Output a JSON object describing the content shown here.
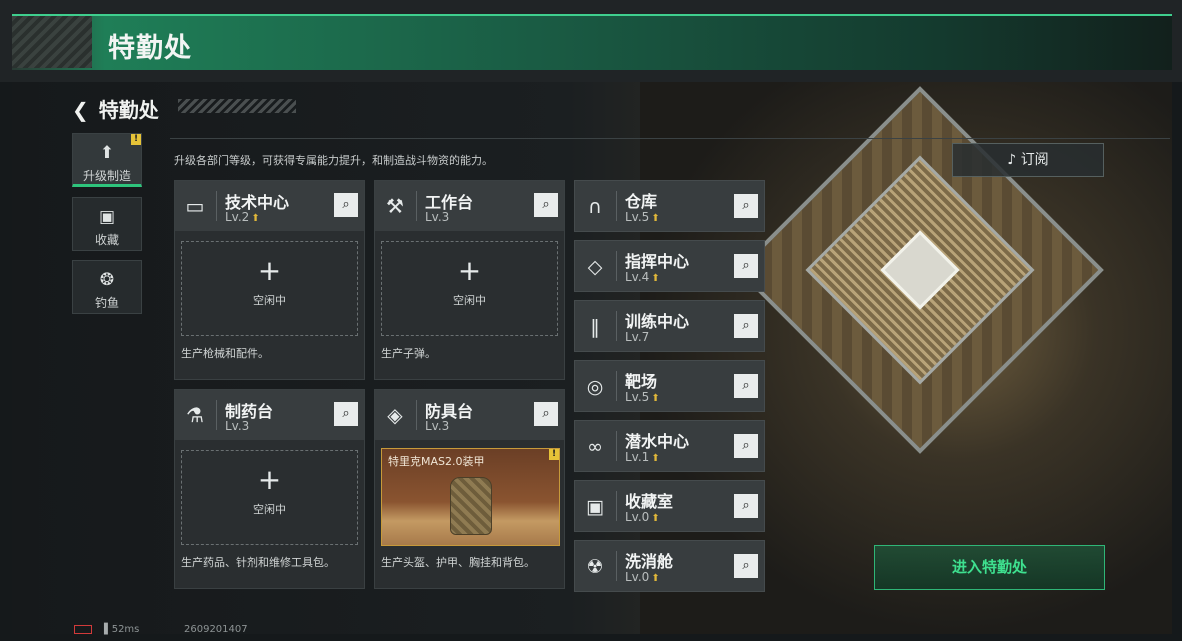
{
  "window_title": "特勤处",
  "header": {
    "back_label": "特勤处"
  },
  "description": "升级各部门等级，可获得专属能力提升，和制造战斗物资的能力。",
  "sidebar": [
    {
      "label": "升级制造",
      "icon": "upgrade-icon",
      "active": true,
      "warning": "!"
    },
    {
      "label": "收藏",
      "icon": "collection-icon"
    },
    {
      "label": "钓鱼",
      "icon": "fish-icon"
    }
  ],
  "cards": [
    {
      "name": "技术中心",
      "level": "Lv.2",
      "icon": "monitor-icon",
      "slot": "空闲中",
      "note": "生产枪械和配件。"
    },
    {
      "name": "工作台",
      "level": "Lv.3",
      "icon": "tools-icon",
      "slot": "空闲中",
      "note": "生产子弹。"
    },
    {
      "name": "制药台",
      "level": "Lv.3",
      "icon": "microscope-icon",
      "slot": "空闲中",
      "note": "生产药品、针剂和维修工具包。"
    },
    {
      "name": "防具台",
      "level": "Lv.3",
      "icon": "armor-icon",
      "item": "特里克MAS2.0装甲",
      "warning": "!",
      "note": "生产头盔、护甲、胸挂和背包。"
    }
  ],
  "facilities": [
    {
      "name": "仓库",
      "level": "Lv.5",
      "icon": "warehouse-icon"
    },
    {
      "name": "指挥中心",
      "level": "Lv.4",
      "icon": "chip-icon"
    },
    {
      "name": "训练中心",
      "level": "Lv.7",
      "icon": "dumbbell-icon"
    },
    {
      "name": "靶场",
      "level": "Lv.5",
      "icon": "target-icon"
    },
    {
      "name": "潜水中心",
      "level": "Lv.1",
      "icon": "diving-mask-icon"
    },
    {
      "name": "收藏室",
      "level": "Lv.0",
      "icon": "collection-room-icon"
    },
    {
      "name": "洗消舱",
      "level": "Lv.0",
      "icon": "decontamination-icon"
    }
  ],
  "subscribe_label": "订阅",
  "enter_label": "进入特勤处",
  "status": {
    "ping": "52ms",
    "uid": "2609201407"
  },
  "colors": {
    "accent": "#2ec47c",
    "warning": "#e6c338",
    "upgrade": "#e0b73a"
  }
}
